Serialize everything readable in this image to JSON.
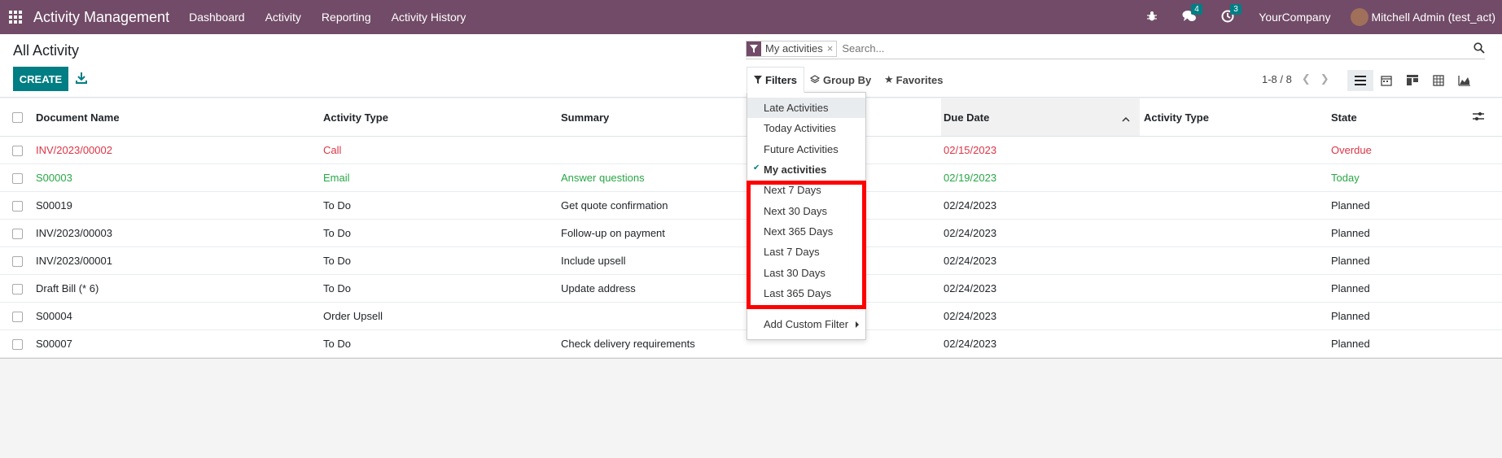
{
  "navbar": {
    "brand": "Activity Management",
    "menu": [
      "Dashboard",
      "Activity",
      "Reporting",
      "Activity History"
    ],
    "messages_count": "4",
    "activities_count": "3",
    "company": "YourCompany",
    "user": "Mitchell Admin (test_act)"
  },
  "control_panel": {
    "title": "All Activity",
    "create_label": "CREATE",
    "search_facet": "My activities",
    "search_placeholder": "Search...",
    "filters_label": "Filters",
    "groupby_label": "Group By",
    "favorites_label": "Favorites",
    "pager": "1-8 / 8"
  },
  "filters_menu": {
    "items": [
      "Late Activities",
      "Today Activities",
      "Future Activities",
      "My activities"
    ],
    "date_items": [
      "Next 7 Days",
      "Next 30 Days",
      "Next 365 Days",
      "Last 7 Days",
      "Last 30 Days",
      "Last 365 Days"
    ],
    "custom": "Add Custom Filter"
  },
  "table": {
    "headers": {
      "document": "Document Name",
      "type": "Activity Type",
      "summary": "Summary",
      "due": "Due Date",
      "type2": "Activity Type",
      "state": "State"
    },
    "rows": [
      {
        "doc": "INV/2023/00002",
        "type": "Call",
        "summary": "",
        "due": "02/15/2023",
        "state": "Overdue"
      },
      {
        "doc": "S00003",
        "type": "Email",
        "summary": "Answer questions",
        "due": "02/19/2023",
        "state": "Today"
      },
      {
        "doc": "S00019",
        "type": "To Do",
        "summary": "Get quote confirmation",
        "due": "02/24/2023",
        "state": "Planned"
      },
      {
        "doc": "INV/2023/00003",
        "type": "To Do",
        "summary": "Follow-up on payment",
        "due": "02/24/2023",
        "state": "Planned"
      },
      {
        "doc": "INV/2023/00001",
        "type": "To Do",
        "summary": "Include upsell",
        "due": "02/24/2023",
        "state": "Planned"
      },
      {
        "doc": "Draft Bill (* 6)",
        "type": "To Do",
        "summary": "Update address",
        "due": "02/24/2023",
        "state": "Planned"
      },
      {
        "doc": "S00004",
        "type": "Order Upsell",
        "summary": "",
        "due": "02/24/2023",
        "state": "Planned"
      },
      {
        "doc": "S00007",
        "type": "To Do",
        "summary": "Check delivery requirements",
        "due": "02/24/2023",
        "state": "Planned"
      }
    ]
  },
  "colors": {
    "brand": "#714b67",
    "primary": "#017e84",
    "overdue": "#dc3545",
    "today": "#28a745",
    "highlight": "#ff0000"
  }
}
